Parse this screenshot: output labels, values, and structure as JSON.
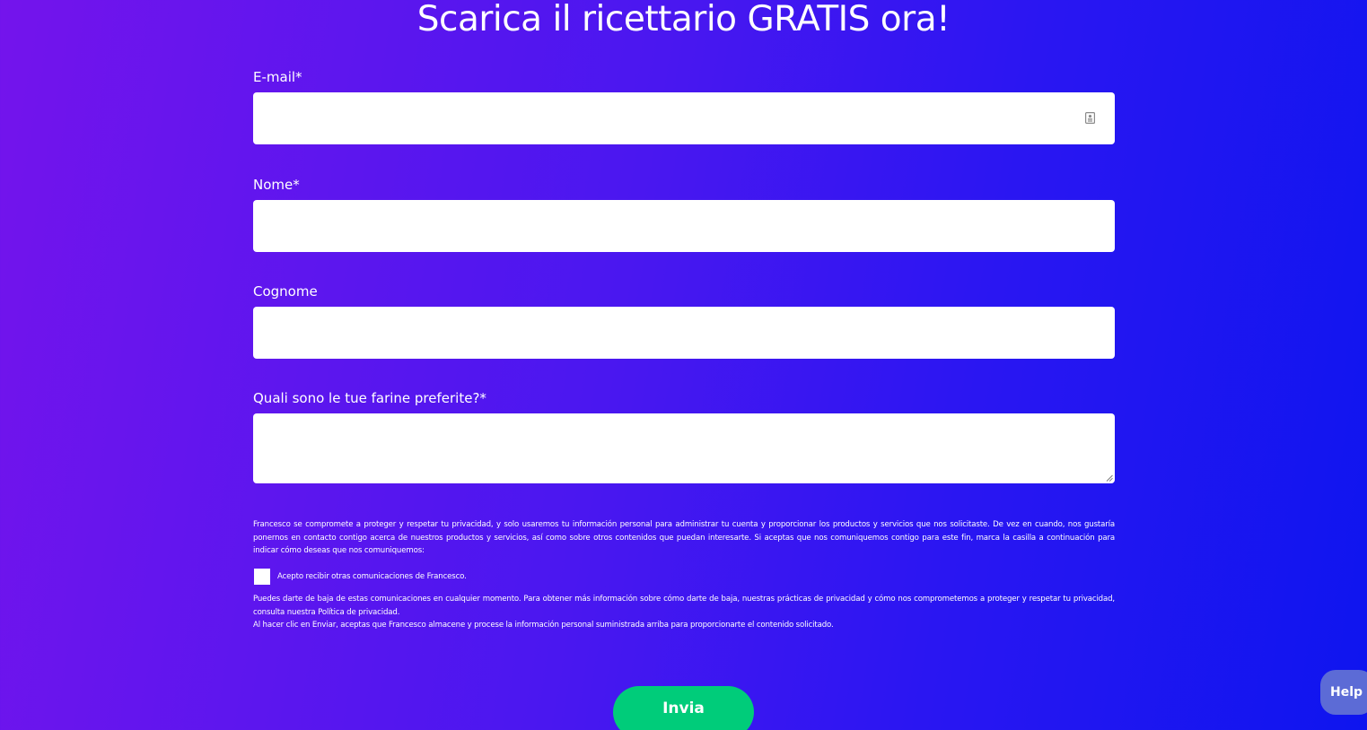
{
  "page": {
    "title": "Scarica il ricettario GRATIS ora!"
  },
  "form": {
    "email": {
      "label": "E-mail*",
      "value": "",
      "icon": "contact-card-icon"
    },
    "nome": {
      "label": "Nome*",
      "value": ""
    },
    "cognome": {
      "label": "Cognome",
      "value": ""
    },
    "farine": {
      "label": "Quali sono le tue farine preferite?*",
      "value": ""
    }
  },
  "legal": {
    "privacy_intro": "Francesco se compromete a proteger y respetar tu privacidad, y solo usaremos tu información personal para administrar tu cuenta y proporcionar los productos y servicios que nos solicitaste. De vez en cuando, nos gustaría ponernos en contacto contigo acerca de nuestros productos y servicios, así como sobre otros contenidos que puedan interesarte. Si aceptas que nos comuniquemos contigo para este fin, marca la casilla a continuación para indicar cómo deseas que nos comuniquemos:",
    "consent_label": "Acepto recibir otras comunicaciones de Francesco.",
    "consent_checked": false,
    "unsubscribe_info": "Puedes darte de baja de estas comunicaciones en cualquier momento. Para obtener más información sobre cómo darte de baja, nuestras prácticas de privacidad y cómo nos comprometemos a proteger y respetar tu privacidad, consulta nuestra Política de privacidad.",
    "submit_notice": "Al hacer clic en Enviar, aceptas que Francesco almacene y procese la información personal suministrada arriba para proporcionarte el contenido solicitado."
  },
  "actions": {
    "submit_label": "Invia",
    "help_label": "Help"
  },
  "colors": {
    "background_start": "#7414ec",
    "background_end": "#0e15ef",
    "submit": "#00cc7a",
    "help": "#5c6bd6"
  }
}
